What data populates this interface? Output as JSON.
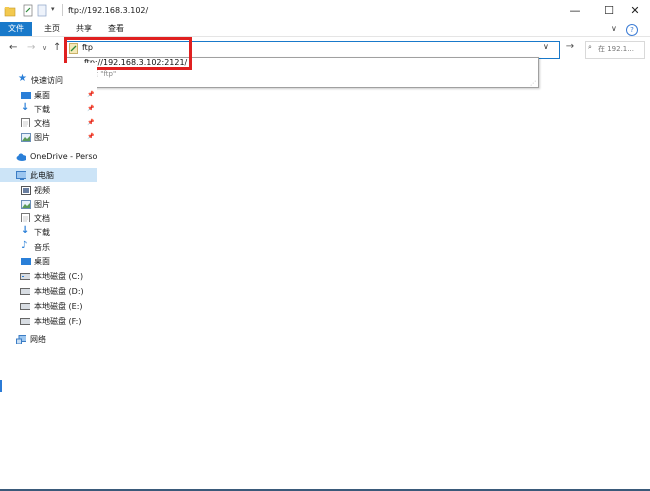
{
  "window": {
    "title": "ftp://192.168.3.102/",
    "minimize": "—",
    "maximize": "☐",
    "close": "✕"
  },
  "ribbon": {
    "tabs": [
      "文件",
      "主页",
      "共享",
      "查看"
    ],
    "help": "?",
    "expand": "∨"
  },
  "nav": {
    "back": "←",
    "forward": "→",
    "recent": "∨",
    "up": "↑",
    "address_value": "ftp",
    "dropdown": "∨",
    "go": "→",
    "search_placeholder": "在 192.1..."
  },
  "autocomplete": {
    "item": "ftp://192.168.3.102:2121/",
    "hint": "搜索 \"ftp\""
  },
  "sidebar": {
    "quick_access": {
      "label": "快速访问",
      "items": [
        {
          "label": "桌面",
          "icon": "desktop-icon",
          "pinned": true
        },
        {
          "label": "下载",
          "icon": "download-icon",
          "pinned": true
        },
        {
          "label": "文档",
          "icon": "document-icon",
          "pinned": true
        },
        {
          "label": "图片",
          "icon": "picture-icon",
          "pinned": true
        }
      ]
    },
    "onedrive": {
      "label": "OneDrive - Personal"
    },
    "this_pc": {
      "label": "此电脑",
      "items": [
        {
          "label": "视频",
          "icon": "video-icon"
        },
        {
          "label": "图片",
          "icon": "picture-icon"
        },
        {
          "label": "文档",
          "icon": "document-icon"
        },
        {
          "label": "下载",
          "icon": "download-icon"
        },
        {
          "label": "音乐",
          "icon": "music-icon"
        },
        {
          "label": "桌面",
          "icon": "desktop-icon"
        },
        {
          "label": "本地磁盘 (C:)",
          "icon": "drive-icon"
        },
        {
          "label": "本地磁盘 (D:)",
          "icon": "drive-icon"
        },
        {
          "label": "本地磁盘 (E:)",
          "icon": "drive-icon"
        },
        {
          "label": "本地磁盘 (F:)",
          "icon": "drive-icon"
        }
      ]
    },
    "network": {
      "label": "网络"
    }
  },
  "colors": {
    "accent": "#1979ca",
    "highlight_box": "#e02020",
    "selected_bg": "#cce4f7"
  }
}
